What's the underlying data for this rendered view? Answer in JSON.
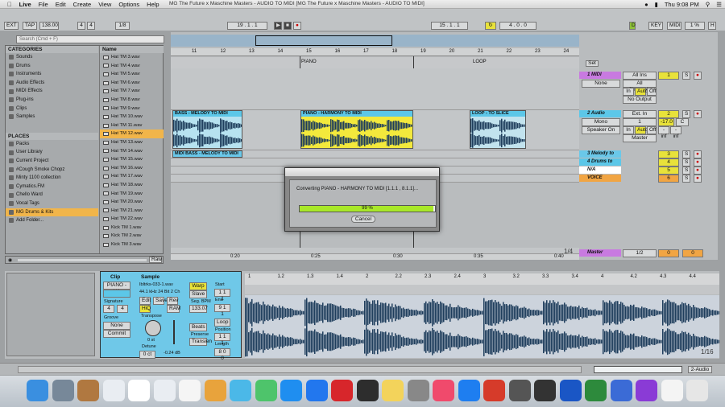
{
  "menubar": {
    "app": "Live",
    "items": [
      "File",
      "Edit",
      "Create",
      "View",
      "Options",
      "Help"
    ],
    "title": "MG The Future x Maschine Masters - AUDIO TO MIDI [MG The Future x Maschine Masters - AUDIO TO MIDI]",
    "clock": "Thu 9:08 PM"
  },
  "transport": {
    "ext": "EXT",
    "tap": "TAP",
    "tempo": "138.00",
    "sig_num": "4",
    "sig_den": "4",
    "quant": "1/8",
    "position": "19 . 1 . 1",
    "loop_start": "15 . 1 . 1",
    "loop_len": "4 . 0 . 0",
    "key": "KEY",
    "midi": "MIDI",
    "cpu": "1 %",
    "d_label": "D"
  },
  "browser": {
    "search_placeholder": "Search (Cmd + F)",
    "categories_header": "CATEGORIES",
    "categories": [
      "Sounds",
      "Drums",
      "Instruments",
      "Audio Effects",
      "MIDI Effects",
      "Plug-ins",
      "Clips",
      "Samples"
    ],
    "places_header": "PLACES",
    "places": [
      "Packs",
      "User Library",
      "Current Project",
      "#Cough Smoke Chopz",
      "Minty 1100 collection",
      "Cymatics.FM",
      "Chello Ward",
      "Vocal Tags",
      "MG Drums & Kits",
      "Add Folder..."
    ],
    "name_header": "Name",
    "files": [
      "Hat TM 3.wav",
      "Hat TM 4.wav",
      "Hat TM 5.wav",
      "Hat TM 6.wav",
      "Hat TM 7.wav",
      "Hat TM 8.wav",
      "Hat TM 9.wav",
      "Hat TM 10.wav",
      "Hat TM 11.wav",
      "Hat TM 12.wav",
      "Hat TM 13.wav",
      "Hat TM 14.wav",
      "Hat TM 15.wav",
      "Hat TM 16.wav",
      "Hat TM 17.wav",
      "Hat TM 18.wav",
      "Hat TM 19.wav",
      "Hat TM 20.wav",
      "Hat TM 21.wav",
      "Hat TM 22.wav",
      "Kick TM 1.wav",
      "Kick TM 2.wav",
      "Kick TM 3.wav"
    ],
    "raw": "Raw"
  },
  "arrangement": {
    "ruler": [
      "11",
      "12",
      "13",
      "14",
      "15",
      "16",
      "17",
      "18",
      "19",
      "20",
      "21",
      "22",
      "23",
      "24"
    ],
    "locators": [
      "PIANO",
      "LOOP"
    ],
    "clips": {
      "bass": "BASS - MELODY TO MIDI",
      "piano": "PIANO - HARMONY TO MIDI",
      "loop": "LOOP - TO SLICE",
      "midi_bass": "MIDI BASS - MELODY TO MIDI"
    },
    "time": [
      "0:20",
      "0:25",
      "0:30",
      "0:35",
      "0:40"
    ],
    "zoom": "1/4"
  },
  "mixer": {
    "set": "Set",
    "tracks": [
      {
        "name": "1 MIDI",
        "color": "#c87ae0",
        "num": "1"
      },
      {
        "name": "2 Audio",
        "color": "#5cc7e8",
        "num": "2"
      },
      {
        "name": "3 Melody to",
        "color": "#6ac8e9",
        "num": "3"
      },
      {
        "name": "4 Drums to",
        "color": "#5cc7e8",
        "num": "4"
      },
      {
        "name": "N/A",
        "color": "#ffffff",
        "num": "5"
      },
      {
        "name": "VOICE",
        "color": "#f1a543",
        "num": "6"
      }
    ],
    "master": "Master",
    "master_val": "1/2",
    "all_ins": "All Ins",
    "all_channels": "All Channels",
    "none": "None",
    "no_output": "No Output",
    "ext_in": "Ext. In",
    "mono": "Mono",
    "speaker_on": "Speaker On",
    "in": "In",
    "auto": "Auto",
    "off": "Off",
    "inf": "-inf",
    "vol": "-17.0",
    "pan": "C",
    "master_out": "Master",
    "s": "S",
    "zeros": [
      "0",
      "0"
    ]
  },
  "dialog": {
    "text": "Converting PIANO - HARMONY TO MIDI [1.1.1 , 8.1.1]...",
    "percent": "99 %",
    "progress": 0.99,
    "cancel": "Cancel"
  },
  "detail": {
    "clip_label": "Clip",
    "sample_label": "Sample",
    "clip_name": "PIANO - HA",
    "signature": "Signature",
    "sig_num": "4",
    "sig_den": "4",
    "groove": "Groove",
    "groove_val": "None",
    "commit": "Commit",
    "file": "Ibltrks-033-1.wav",
    "format": "44.1 kHz 24 Bit 2 Ch",
    "edit": "Edit",
    "save": "Save",
    "rev": "Rev",
    "hiq": "HiQ",
    "ram": "RAM",
    "transpose": "Transpose",
    "transpose_val": "0 st",
    "detune": "Detune",
    "detune_val": "0 ct",
    "vol_val": "-0.24 dB",
    "warp": "Warp",
    "seg_bpm": "Seg. BPM",
    "bpm": "133.07",
    "beats": "Beats",
    "preserve": "Preserve",
    "transients": "Transien",
    "start": "Start",
    "end": "End",
    "loop": "Loop",
    "position": "Position",
    "length": "Length",
    "ruler": [
      "1",
      "1.2",
      "1.3",
      "1.4",
      "2",
      "2.2",
      "2.3",
      "2.4",
      "3",
      "3.2",
      "3.3",
      "3.4",
      "4",
      "4.2",
      "4.3",
      "4.4"
    ],
    "zoom": "1/16"
  },
  "footer": {
    "track": "2-Audio"
  }
}
